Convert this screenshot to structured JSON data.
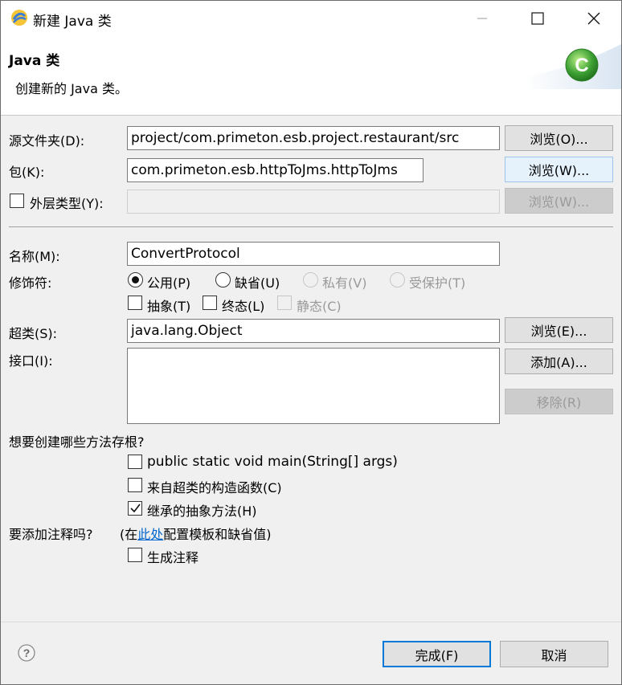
{
  "window": {
    "title": "新建 Java 类"
  },
  "header": {
    "title": "Java 类",
    "description": "创建新的 Java 类。",
    "icon": "java-class-icon",
    "accent": "#3da033"
  },
  "form": {
    "source_folder": {
      "label": "源文件夹(D):",
      "value": "project/com.primeton.esb.project.restaurant/src",
      "browse_label": "浏览(O)..."
    },
    "package": {
      "label": "包(K):",
      "value": "com.primeton.esb.httpToJms.httpToJms",
      "browse_label": "浏览(W)..."
    },
    "enclosing_type": {
      "label": "外层类型(Y):",
      "value": "",
      "browse_label": "浏览(W)...",
      "checked": false
    },
    "name": {
      "label": "名称(M):",
      "value": "ConvertProtocol"
    },
    "modifiers": {
      "label": "修饰符:",
      "public_label": "公用(P)",
      "default_label": "缺省(U)",
      "private_label": "私有(V)",
      "protected_label": "受保护(T)",
      "abstract_label": "抽象(T)",
      "final_label": "终态(L)",
      "static_label": "静态(C)",
      "selected": "公用(P)"
    },
    "superclass": {
      "label": "超类(S):",
      "value": "java.lang.Object",
      "browse_label": "浏览(E)..."
    },
    "interfaces": {
      "label": "接口(I):",
      "add_label": "添加(A)...",
      "remove_label": "移除(R)"
    },
    "stubs": {
      "question": "想要创建哪些方法存根?",
      "main_label": "public static void main(String[] args)",
      "constructors_label": "来自超类的构造函数(C)",
      "inherited_label": "继承的抽象方法(H)",
      "inherited_checked": true
    },
    "comments": {
      "question": "要添加注释吗?",
      "config_prefix": "(在",
      "config_link": "此处",
      "config_suffix": "配置模板和缺省值)",
      "generate_label": "生成注释"
    }
  },
  "footer": {
    "finish_label": "完成(F)",
    "cancel_label": "取消",
    "help_icon": "help-icon"
  }
}
